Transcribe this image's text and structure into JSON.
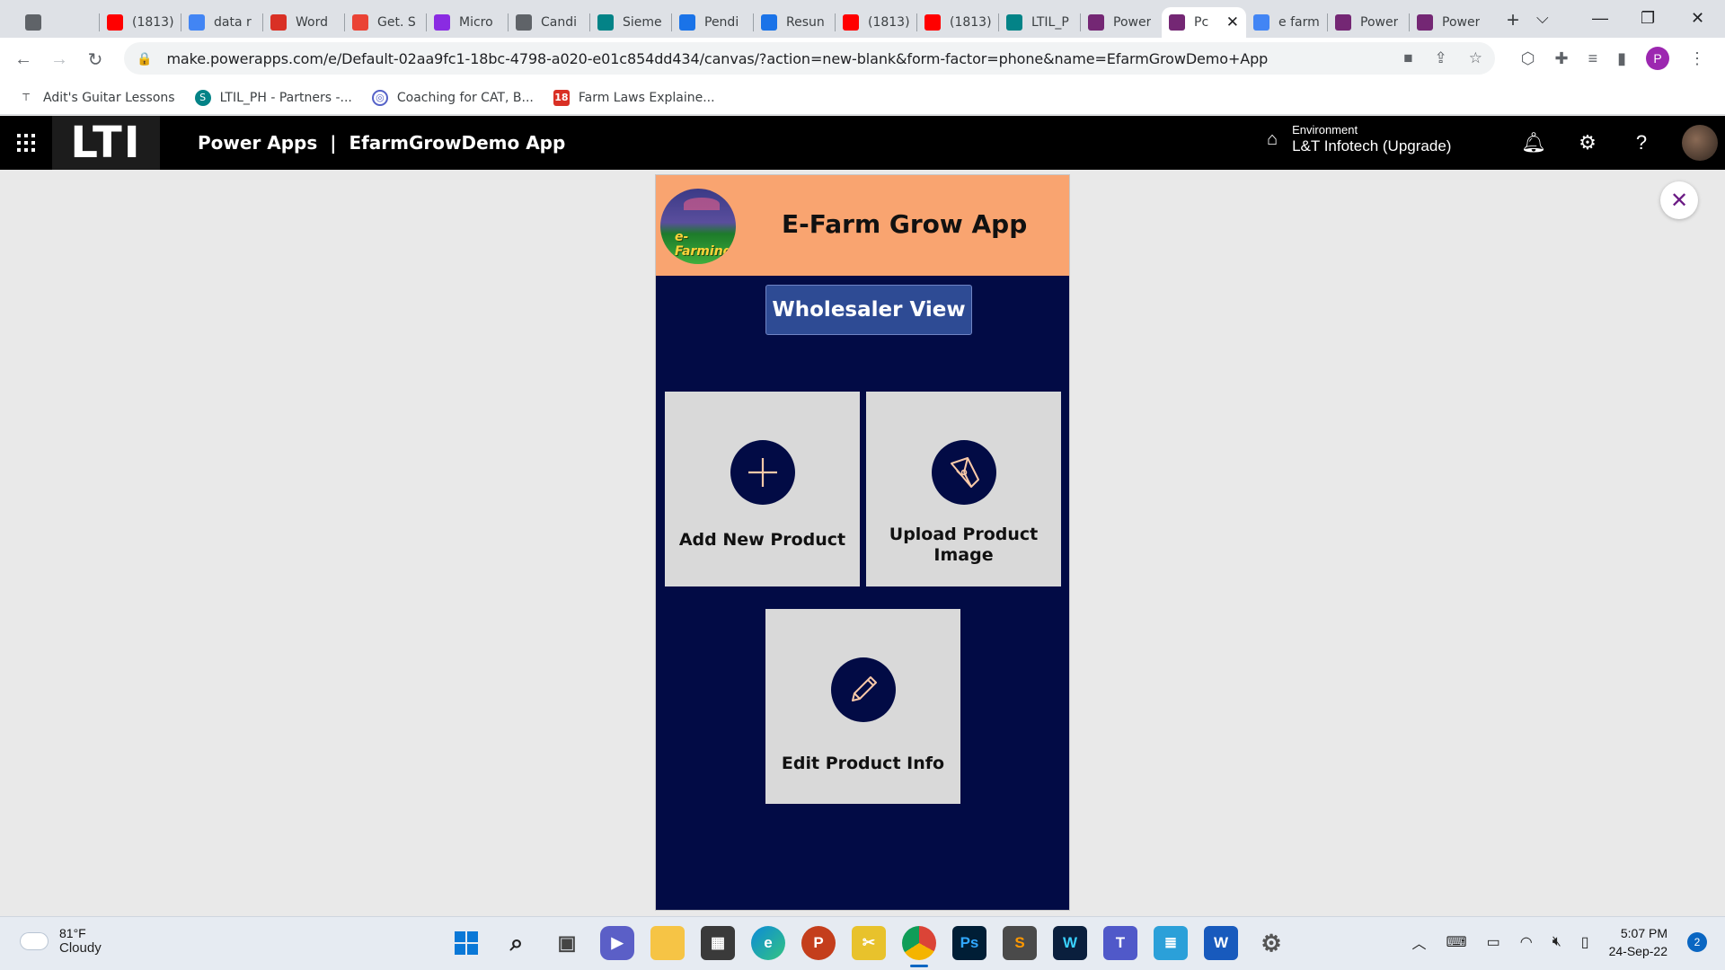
{
  "browser": {
    "tabs": [
      {
        "label": "",
        "icon": "globe-icon",
        "color": "#5f6368"
      },
      {
        "label": "(1813)",
        "icon": "youtube-icon",
        "color": "#ff0000"
      },
      {
        "label": "data r",
        "icon": "google-icon",
        "color": "#4285f4"
      },
      {
        "label": "Word",
        "icon": "s-app-icon",
        "color": "#d93025"
      },
      {
        "label": "Get. S",
        "icon": "gmail-icon",
        "color": "#ea4335"
      },
      {
        "label": "Micro",
        "icon": "accenture-icon",
        "color": "#8a2be2"
      },
      {
        "label": "Candi",
        "icon": "globe-icon",
        "color": "#5f6368"
      },
      {
        "label": "Sieme",
        "icon": "sharepoint-icon",
        "color": "#038387"
      },
      {
        "label": "Pendi",
        "icon": "k-icon",
        "color": "#1a73e8"
      },
      {
        "label": "Resun",
        "icon": "k-icon",
        "color": "#1a73e8"
      },
      {
        "label": "(1813)",
        "icon": "youtube-icon",
        "color": "#ff0000"
      },
      {
        "label": "(1813)",
        "icon": "youtube-icon",
        "color": "#ff0000"
      },
      {
        "label": "LTIL_P",
        "icon": "sharepoint-icon",
        "color": "#038387"
      },
      {
        "label": "Power",
        "icon": "powerapps-icon",
        "color": "#742774"
      },
      {
        "label": "Pc",
        "icon": "powerapps-icon",
        "color": "#742774",
        "active": true
      },
      {
        "label": "e farm",
        "icon": "google-icon",
        "color": "#4285f4"
      },
      {
        "label": "Power",
        "icon": "powerapps-icon",
        "color": "#742774"
      },
      {
        "label": "Power",
        "icon": "powerapps-icon",
        "color": "#742774"
      }
    ],
    "url": "make.powerapps.com/e/Default-02aa9fc1-18bc-4798-a020-e01c854dd434/canvas/?action=new-blank&form-factor=phone&name=EfarmGrowDemo+App",
    "profile_initial": "P",
    "bookmarks": [
      {
        "label": "Adit's Guitar Lessons",
        "icon": "bookmark-icon"
      },
      {
        "label": "LTIL_PH - Partners -...",
        "icon": "sharepoint-icon"
      },
      {
        "label": "Coaching for CAT, B...",
        "icon": "globe-icon"
      },
      {
        "label": "Farm Laws Explaine...",
        "icon": "news18-icon",
        "badge": "18"
      }
    ]
  },
  "powerapps": {
    "brand": "LTI",
    "title": "Power Apps  |  EfarmGrowDemo App",
    "environment_label": "Environment",
    "environment_value": "L&T Infotech (Upgrade)"
  },
  "app": {
    "title": "E-Farm Grow App",
    "logo_text": "e-Farming",
    "view_button": "Wholesaler View",
    "tiles": [
      {
        "label": "Add New Product",
        "icon": "plus-icon"
      },
      {
        "label": "Upload Product Image",
        "icon": "pen-tool-icon"
      },
      {
        "label": "Edit Product Info",
        "icon": "pencil-icon"
      }
    ],
    "colors": {
      "header": "#f9a470",
      "background": "#020b45",
      "tile": "#d9d9d9",
      "button": "#2e4b94"
    }
  },
  "taskbar": {
    "temperature": "81°F",
    "condition": "Cloudy",
    "time": "5:07 PM",
    "date": "24-Sep-22",
    "notifications": "2"
  }
}
